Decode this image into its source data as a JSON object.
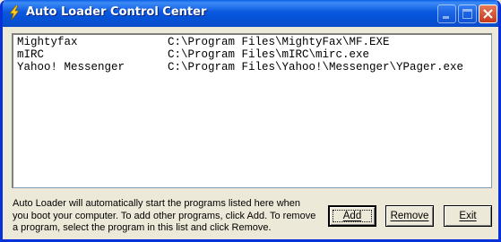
{
  "window": {
    "title": "Auto Loader Control Center",
    "app_icon": "lightning-bolt-icon",
    "controls": {
      "minimize_icon": "minimize-icon",
      "maximize_icon": "maximize-icon",
      "close_icon": "close-icon"
    },
    "colors": {
      "titlebar": "#0a4cc9",
      "close_button": "#c4391b",
      "window_bg": "#ece9d8"
    }
  },
  "program_list": {
    "items": [
      {
        "name": "Mightyfax",
        "path": "C:\\Program Files\\MightyFax\\MF.EXE"
      },
      {
        "name": "mIRC",
        "path": "C:\\Program Files\\mIRC\\mirc.exe"
      },
      {
        "name": "Yahoo! Messenger",
        "path": "C:\\Program Files\\Yahoo!\\Messenger\\YPager.exe"
      }
    ]
  },
  "info_text": "Auto Loader will automatically start the programs listed here when you boot your computer. To add other programs, click Add.  To remove a program, select the program in this list and click Remove.",
  "buttons": {
    "add": "Add",
    "remove": "Remove",
    "exit": "Exit"
  }
}
